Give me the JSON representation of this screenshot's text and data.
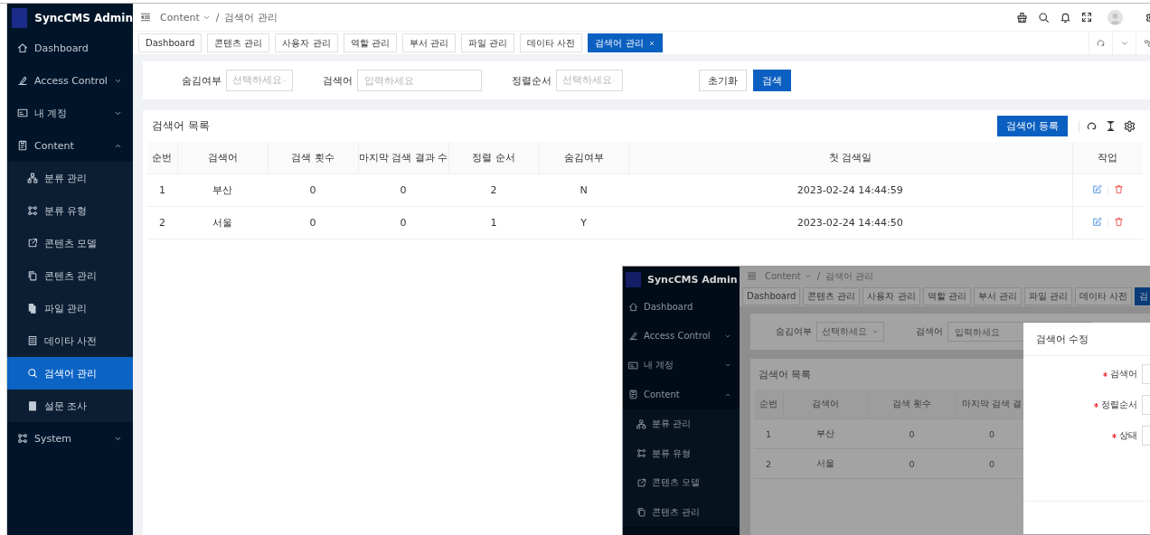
{
  "sidebar": {
    "logo": "SyncCMS Admin",
    "items": [
      {
        "label": "Dashboard",
        "selected": false
      },
      {
        "label": "Access Control",
        "selected": false,
        "expanded": false
      },
      {
        "label": "내 계정",
        "selected": false,
        "expanded": false
      },
      {
        "label": "Content",
        "selected": false,
        "expanded": true,
        "children": [
          {
            "label": "분류 관리",
            "selected": false
          },
          {
            "label": "분류 유형",
            "selected": false
          },
          {
            "label": "콘텐츠 모델",
            "selected": false
          },
          {
            "label": "콘텐츠 관리",
            "selected": false
          },
          {
            "label": "파일 관리",
            "selected": false
          },
          {
            "label": "데이타 사전",
            "selected": false
          },
          {
            "label": "검색어 관리",
            "selected": true
          },
          {
            "label": "설문 조사",
            "selected": false
          }
        ]
      },
      {
        "label": "System",
        "selected": false,
        "expanded": false
      }
    ]
  },
  "header": {
    "breadcrumb": [
      {
        "label": "Content",
        "dropdown": true
      },
      {
        "label": "검색어 관리",
        "dropdown": false
      }
    ],
    "separator": "/"
  },
  "tabs": [
    {
      "label": "Dashboard",
      "selected": false,
      "closable": false
    },
    {
      "label": "콘텐츠 관리",
      "selected": false,
      "closable": false
    },
    {
      "label": "사용자 관리",
      "selected": false,
      "closable": false
    },
    {
      "label": "역할 관리",
      "selected": false,
      "closable": false
    },
    {
      "label": "부서 관리",
      "selected": false,
      "closable": false
    },
    {
      "label": "파일 관리",
      "selected": false,
      "closable": false
    },
    {
      "label": "데이타 사전",
      "selected": false,
      "closable": false
    },
    {
      "label": "검색어 관리",
      "selected": true,
      "closable": true
    }
  ],
  "filter": {
    "fields": [
      {
        "kind": "select",
        "label": "숨김여부",
        "placeholder": "선택하세요"
      },
      {
        "kind": "input",
        "label": "검색어",
        "placeholder": "입력하세요"
      },
      {
        "kind": "select",
        "label": "정렬순서",
        "placeholder": "선택하세요"
      }
    ],
    "buttons": [
      {
        "label": "초기화",
        "primary": false
      },
      {
        "label": "검색",
        "primary": true
      }
    ]
  },
  "list": {
    "title": "검색어 목록",
    "add_button": "검색어 등록",
    "table": {
      "columns": [
        "순번",
        "검색어",
        "검색 횟수",
        "마지막 검색 결과 수",
        "정렬 순서",
        "숨김여부",
        "첫 검색일",
        "작업"
      ],
      "rows": [
        {
          "cells": [
            "1",
            "부산",
            "0",
            "0",
            "2",
            "N",
            "2023-02-24 14:44:59"
          ]
        },
        {
          "cells": [
            "2",
            "서울",
            "0",
            "0",
            "1",
            "Y",
            "2023-02-24 14:44:50"
          ]
        }
      ]
    }
  },
  "inset_screenshot": {
    "logo": "SyncCMS Admin",
    "sidebar_items": [
      {
        "label": "Dashboard",
        "selected": false
      },
      {
        "label": "Access Control",
        "selected": false,
        "expanded": false
      },
      {
        "label": "내 계정",
        "selected": false,
        "expanded": false
      },
      {
        "label": "Content",
        "selected": false,
        "expanded": true,
        "children": [
          {
            "label": "분류 관리",
            "selected": false
          },
          {
            "label": "분류 유형",
            "selected": false
          },
          {
            "label": "콘텐츠 모델",
            "selected": false
          },
          {
            "label": "콘텐츠 관리",
            "selected": false
          }
        ]
      }
    ],
    "breadcrumb": [
      {
        "label": "Content",
        "dropdown": true
      },
      {
        "label": "검색어 관리",
        "dropdown": false
      }
    ],
    "separator": "/",
    "tabs": [
      {
        "label": "Dashboard",
        "selected": false
      },
      {
        "label": "콘텐츠 관리",
        "selected": false
      },
      {
        "label": "사용자 관리",
        "selected": false
      },
      {
        "label": "역할 관리",
        "selected": false
      },
      {
        "label": "부서 관리",
        "selected": false
      },
      {
        "label": "파일 관리",
        "selected": false
      },
      {
        "label": "데이타 사전",
        "selected": false
      },
      {
        "label": "검",
        "selected": true
      }
    ],
    "filter_fields": [
      {
        "kind": "select",
        "label": "숨김여부",
        "placeholder": "선택하세요"
      },
      {
        "kind": "input",
        "label": "검색어",
        "placeholder": "입력하세요"
      }
    ],
    "list_title": "검색어 목록",
    "columns": [
      "순번",
      "검색어",
      "검색 횟수",
      "마지막 검색 결"
    ],
    "rows": [
      {
        "cells": [
          "1",
          "부산",
          "0",
          "0"
        ]
      },
      {
        "cells": [
          "2",
          "서울",
          "0",
          "0"
        ]
      }
    ],
    "modal": {
      "title": "검색어 수정",
      "fields": [
        {
          "label": "검색어",
          "required": true
        },
        {
          "label": "정렬순서",
          "required": true
        },
        {
          "label": "상태",
          "required": true
        }
      ]
    }
  }
}
